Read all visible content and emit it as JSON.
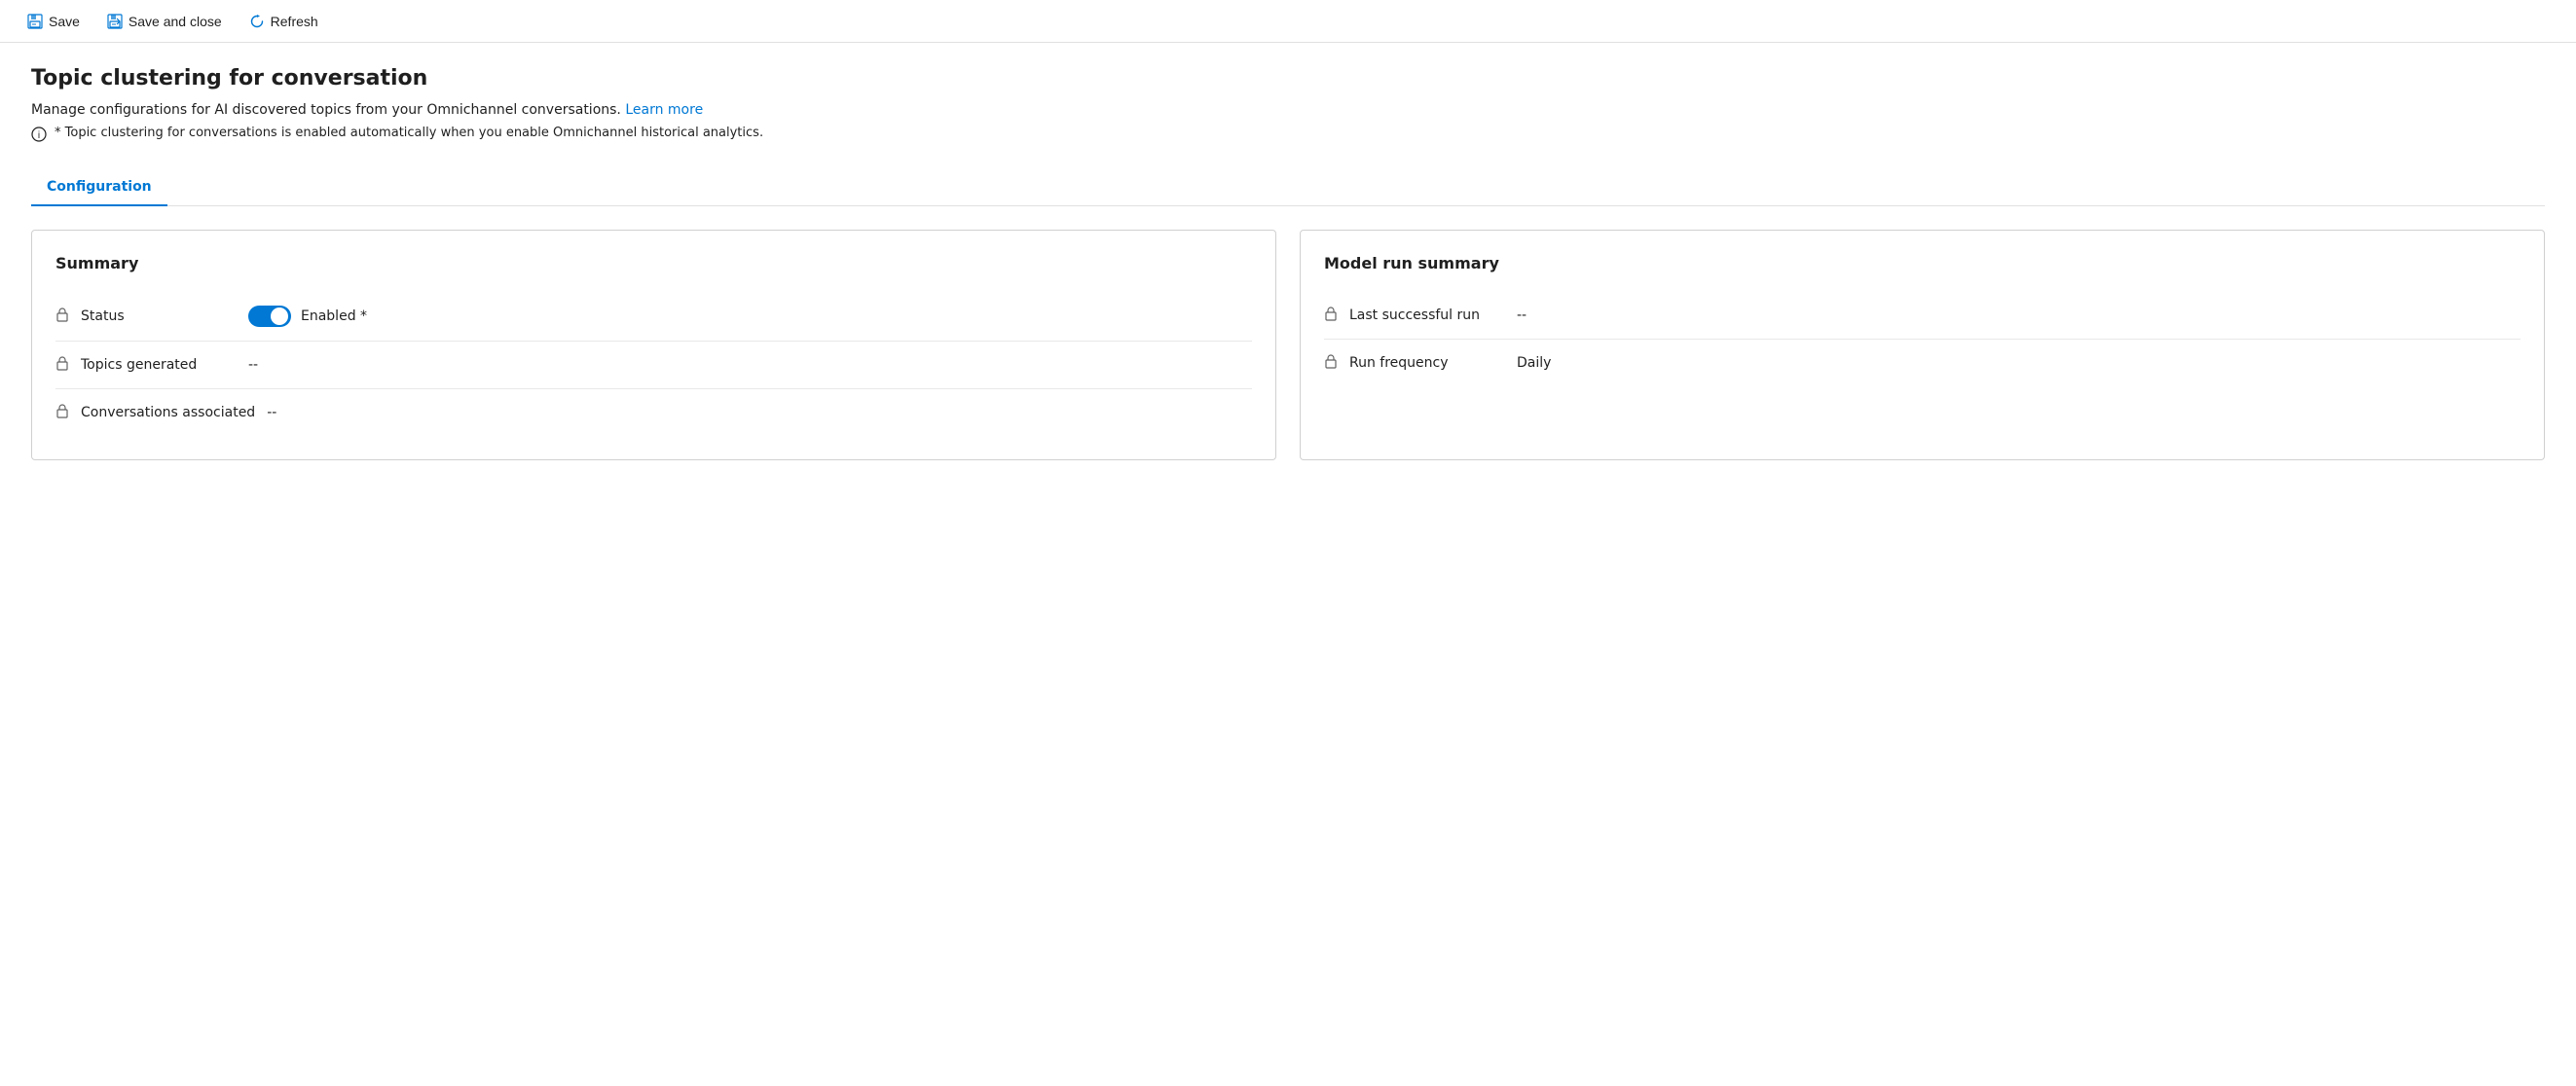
{
  "toolbar": {
    "save_label": "Save",
    "save_close_label": "Save and close",
    "refresh_label": "Refresh"
  },
  "page": {
    "title": "Topic clustering for conversation",
    "description": "Manage configurations for AI discovered topics from your Omnichannel conversations.",
    "learn_more_label": "Learn more",
    "info_note": "* Topic clustering for conversations is enabled automatically when you enable Omnichannel historical analytics."
  },
  "tabs": [
    {
      "label": "Configuration",
      "active": true
    }
  ],
  "summary_card": {
    "title": "Summary",
    "fields": [
      {
        "label": "Status",
        "type": "toggle",
        "toggle_value": true,
        "toggle_label": "Enabled *"
      },
      {
        "label": "Topics generated",
        "value": "--"
      },
      {
        "label": "Conversations associated",
        "value": "--"
      }
    ]
  },
  "model_run_card": {
    "title": "Model run summary",
    "fields": [
      {
        "label": "Last successful run",
        "value": "--"
      },
      {
        "label": "Run frequency",
        "value": "Daily"
      }
    ]
  },
  "icons": {
    "save": "💾",
    "save_close": "📋",
    "refresh": "🔄",
    "lock": "🔒",
    "info": "ℹ"
  }
}
